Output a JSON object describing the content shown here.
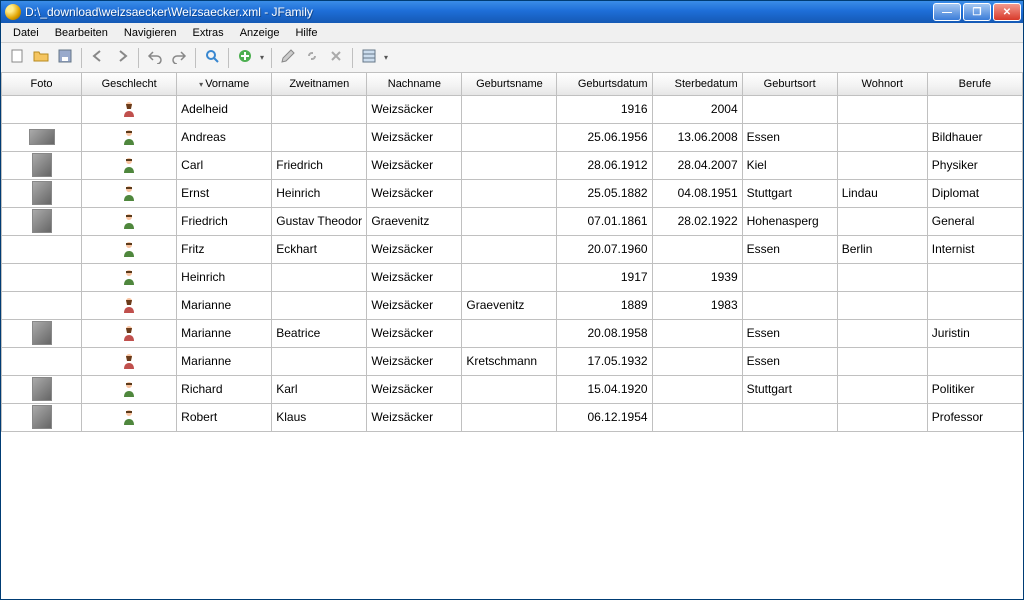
{
  "window": {
    "title": "D:\\_download\\weizsaecker\\Weizsaecker.xml - JFamily"
  },
  "menu": {
    "items": [
      "Datei",
      "Bearbeiten",
      "Navigieren",
      "Extras",
      "Anzeige",
      "Hilfe"
    ]
  },
  "columns": {
    "foto": "Foto",
    "geschlecht": "Geschlecht",
    "vorname": "Vorname",
    "zweitnamen": "Zweitnamen",
    "nachname": "Nachname",
    "geburtsname": "Geburtsname",
    "geburtsdatum": "Geburtsdatum",
    "sterbedatum": "Sterbedatum",
    "geburtsort": "Geburtsort",
    "wohnort": "Wohnort",
    "berufe": "Berufe"
  },
  "sort_column": "vorname",
  "rows": [
    {
      "foto": false,
      "gender": "f",
      "vorname": "Adelheid",
      "zweit": "",
      "nach": "Weizsäcker",
      "geburtsname": "",
      "geburtsdatum": "1916",
      "sterbedatum": "2004",
      "geburtsort": "",
      "wohnort": "",
      "berufe": ""
    },
    {
      "foto": "wide",
      "gender": "m",
      "vorname": "Andreas",
      "zweit": "",
      "nach": "Weizsäcker",
      "geburtsname": "",
      "geburtsdatum": "25.06.1956",
      "sterbedatum": "13.06.2008",
      "geburtsort": "Essen",
      "wohnort": "",
      "berufe": "Bildhauer"
    },
    {
      "foto": true,
      "gender": "m",
      "vorname": "Carl",
      "zweit": "Friedrich",
      "nach": "Weizsäcker",
      "geburtsname": "",
      "geburtsdatum": "28.06.1912",
      "sterbedatum": "28.04.2007",
      "geburtsort": "Kiel",
      "wohnort": "",
      "berufe": "Physiker"
    },
    {
      "foto": true,
      "gender": "m",
      "vorname": "Ernst",
      "zweit": "Heinrich",
      "nach": "Weizsäcker",
      "geburtsname": "",
      "geburtsdatum": "25.05.1882",
      "sterbedatum": "04.08.1951",
      "geburtsort": "Stuttgart",
      "wohnort": "Lindau",
      "berufe": "Diplomat"
    },
    {
      "foto": true,
      "gender": "m",
      "vorname": "Friedrich",
      "zweit": "Gustav Theodor",
      "nach": "Graevenitz",
      "geburtsname": "",
      "geburtsdatum": "07.01.1861",
      "sterbedatum": "28.02.1922",
      "geburtsort": "Hohenasperg",
      "wohnort": "",
      "berufe": "General"
    },
    {
      "foto": false,
      "gender": "m",
      "vorname": "Fritz",
      "zweit": "Eckhart",
      "nach": "Weizsäcker",
      "geburtsname": "",
      "geburtsdatum": "20.07.1960",
      "sterbedatum": "",
      "geburtsort": "Essen",
      "wohnort": "Berlin",
      "berufe": "Internist"
    },
    {
      "foto": false,
      "gender": "m",
      "vorname": "Heinrich",
      "zweit": "",
      "nach": "Weizsäcker",
      "geburtsname": "",
      "geburtsdatum": "1917",
      "sterbedatum": "1939",
      "geburtsort": "",
      "wohnort": "",
      "berufe": ""
    },
    {
      "foto": false,
      "gender": "f",
      "vorname": "Marianne",
      "zweit": "",
      "nach": "Weizsäcker",
      "geburtsname": "Graevenitz",
      "geburtsdatum": "1889",
      "sterbedatum": "1983",
      "geburtsort": "",
      "wohnort": "",
      "berufe": ""
    },
    {
      "foto": true,
      "gender": "f",
      "vorname": "Marianne",
      "zweit": "Beatrice",
      "nach": "Weizsäcker",
      "geburtsname": "",
      "geburtsdatum": "20.08.1958",
      "sterbedatum": "",
      "geburtsort": "Essen",
      "wohnort": "",
      "berufe": "Juristin"
    },
    {
      "foto": false,
      "gender": "f",
      "vorname": "Marianne",
      "zweit": "",
      "nach": "Weizsäcker",
      "geburtsname": "Kretschmann",
      "geburtsdatum": "17.05.1932",
      "sterbedatum": "",
      "geburtsort": "Essen",
      "wohnort": "",
      "berufe": ""
    },
    {
      "foto": true,
      "gender": "m",
      "vorname": "Richard",
      "zweit": "Karl",
      "nach": "Weizsäcker",
      "geburtsname": "",
      "geburtsdatum": "15.04.1920",
      "sterbedatum": "",
      "geburtsort": "Stuttgart",
      "wohnort": "",
      "berufe": "Politiker"
    },
    {
      "foto": true,
      "gender": "m",
      "vorname": "Robert",
      "zweit": "Klaus",
      "nach": "Weizsäcker",
      "geburtsname": "",
      "geburtsdatum": "06.12.1954",
      "sterbedatum": "",
      "geburtsort": "",
      "wohnort": "",
      "berufe": "Professor"
    }
  ]
}
